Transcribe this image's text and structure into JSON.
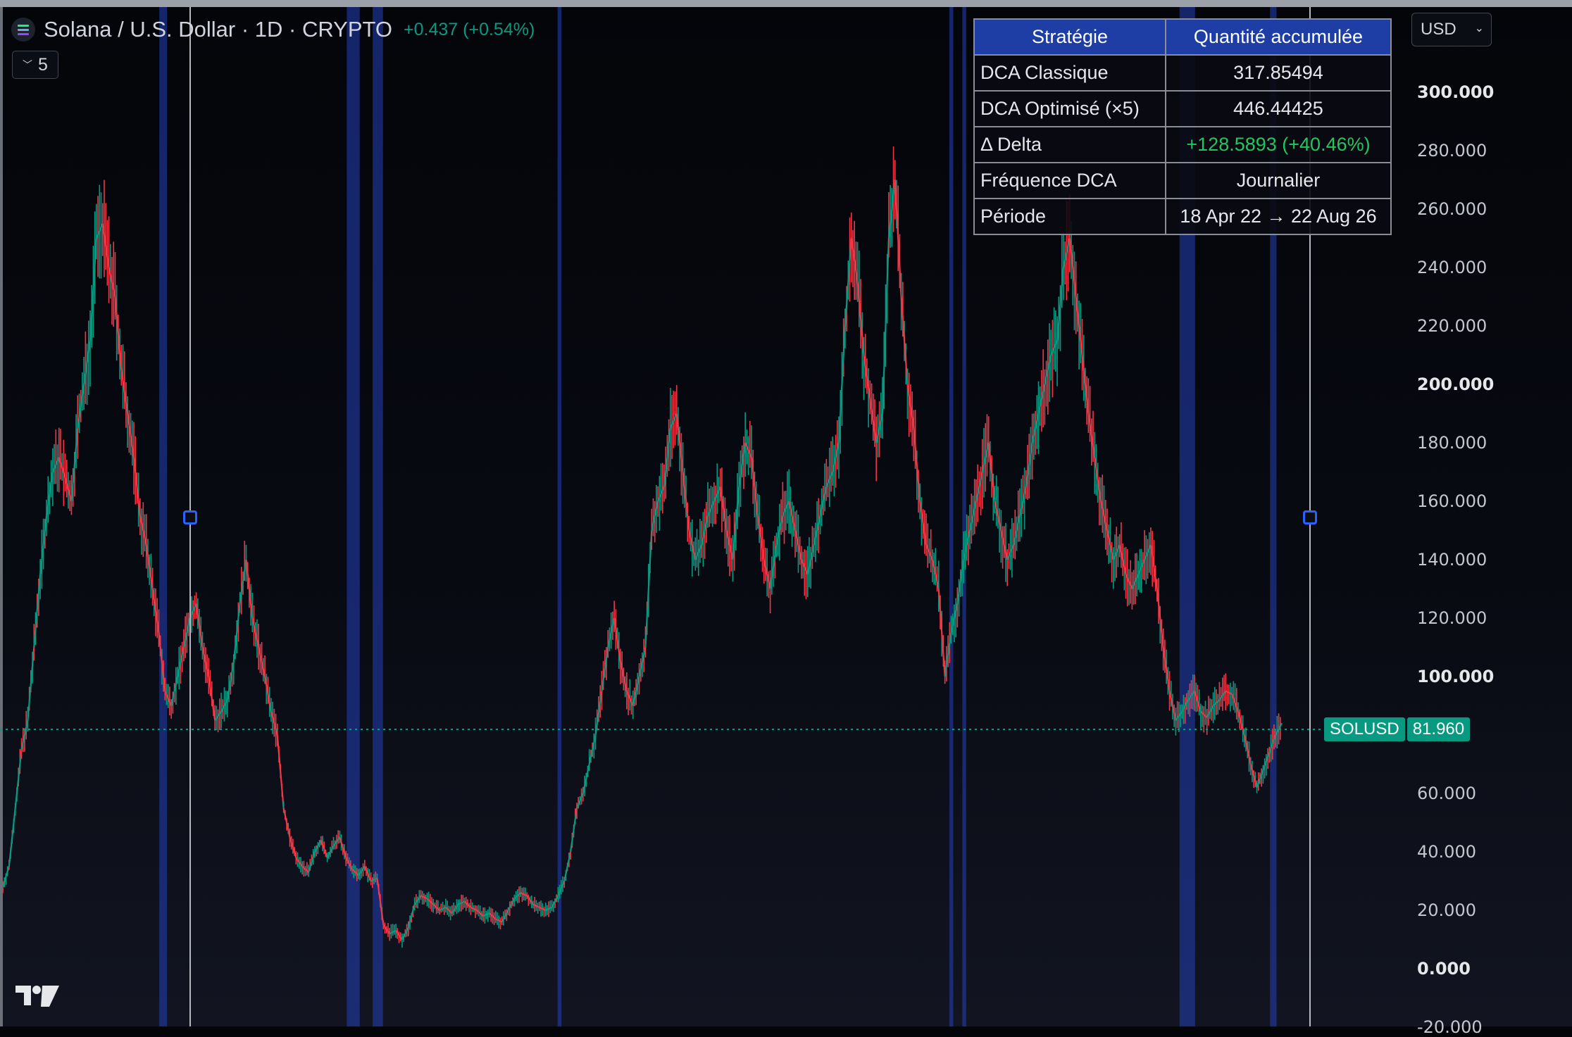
{
  "header": {
    "title": "Solana / U.S. Dollar · 1D · CRYPTO",
    "change": "+0.437 (+0.54%)",
    "interval_count": "5",
    "currency": "USD"
  },
  "symbol_tag": {
    "symbol": "SOLUSD",
    "price": "81.960"
  },
  "table": {
    "headers": [
      "Stratégie",
      "Quantité accumulée"
    ],
    "rows": [
      {
        "label": "DCA Classique",
        "value": "317.85494"
      },
      {
        "label": "DCA Optimisé (×5)",
        "value": "446.44425"
      },
      {
        "label": "Δ Delta",
        "value": "+128.5893 (+40.46%)"
      },
      {
        "label": "Fréquence DCA",
        "value": "Journalier"
      },
      {
        "label": "Période",
        "value": "18 Apr 22 → 22 Aug 26"
      }
    ]
  },
  "colors": {
    "up": "#089981",
    "down": "#f23645",
    "band": "#2440b8",
    "accent": "#2962ff",
    "delta": "#22c55e"
  },
  "chart_data": {
    "type": "line",
    "style": "candlestick-like price series",
    "ylim": [
      -15,
      320
    ],
    "y_ticks": [
      {
        "label": "300.000",
        "value": 300,
        "bold": true
      },
      {
        "label": "280.000",
        "value": 280
      },
      {
        "label": "260.000",
        "value": 260
      },
      {
        "label": "240.000",
        "value": 240
      },
      {
        "label": "220.000",
        "value": 220
      },
      {
        "label": "200.000",
        "value": 200,
        "bold": true
      },
      {
        "label": "180.000",
        "value": 180
      },
      {
        "label": "160.000",
        "value": 160
      },
      {
        "label": "140.000",
        "value": 140
      },
      {
        "label": "120.000",
        "value": 120
      },
      {
        "label": "100.000",
        "value": 100,
        "bold": true
      },
      {
        "label": "60.000",
        "value": 60
      },
      {
        "label": "40.000",
        "value": 40
      },
      {
        "label": "20.000",
        "value": 20
      },
      {
        "label": "0.000",
        "value": 0,
        "bold": true
      },
      {
        "label": "-20.000",
        "value": -20
      }
    ],
    "last_price": 81.96,
    "date_range": [
      "2022-04-18",
      "2026-08-22"
    ],
    "series": [
      {
        "values": [
          28,
          35,
          55,
          75,
          85,
          110,
          135,
          155,
          170,
          175,
          168,
          160,
          185,
          200,
          215,
          250,
          255,
          240,
          230,
          205,
          190,
          175,
          155,
          145,
          130,
          115,
          95,
          90,
          100,
          110,
          120,
          125,
          110,
          100,
          85,
          88,
          92,
          105,
          125,
          140,
          120,
          110,
          100,
          88,
          80,
          55,
          45,
          38,
          35,
          33,
          40,
          44,
          38,
          42,
          45,
          38,
          34,
          32,
          35,
          30,
          31,
          15,
          12,
          13,
          10,
          14,
          22,
          25,
          24,
          22,
          20,
          21,
          19,
          22,
          23,
          21,
          20,
          18,
          19,
          17,
          16,
          20,
          24,
          26,
          25,
          22,
          21,
          20,
          21,
          25,
          30,
          40,
          55,
          60,
          70,
          80,
          95,
          110,
          120,
          105,
          95,
          90,
          100,
          110,
          150,
          160,
          165,
          185,
          190,
          170,
          150,
          140,
          145,
          155,
          160,
          165,
          150,
          140,
          165,
          180,
          175,
          155,
          140,
          130,
          145,
          155,
          160,
          150,
          140,
          135,
          145,
          155,
          165,
          170,
          180,
          220,
          250,
          235,
          210,
          195,
          180,
          190,
          250,
          270,
          230,
          200,
          185,
          160,
          145,
          140,
          130,
          100,
          115,
          125,
          140,
          150,
          160,
          170,
          180,
          160,
          150,
          140,
          145,
          155,
          165,
          180,
          190,
          200,
          210,
          215,
          240,
          250,
          230,
          210,
          190,
          175,
          160,
          150,
          140,
          145,
          135,
          130,
          135,
          140,
          145,
          130,
          110,
          95,
          85,
          88,
          92,
          95,
          88,
          86,
          90,
          92,
          95,
          94,
          88,
          80,
          70,
          62,
          68,
          74,
          80,
          84
        ]
      }
    ],
    "bands": [
      {
        "from": 0.121,
        "to": 0.127
      },
      {
        "from": 0.266,
        "to": 0.276
      },
      {
        "from": 0.286,
        "to": 0.294
      },
      {
        "from": 0.429,
        "to": 0.432
      },
      {
        "from": 0.732,
        "to": 0.735
      },
      {
        "from": 0.742,
        "to": 0.745
      },
      {
        "from": 0.91,
        "to": 0.922
      },
      {
        "from": 0.98,
        "to": 0.985
      }
    ]
  }
}
